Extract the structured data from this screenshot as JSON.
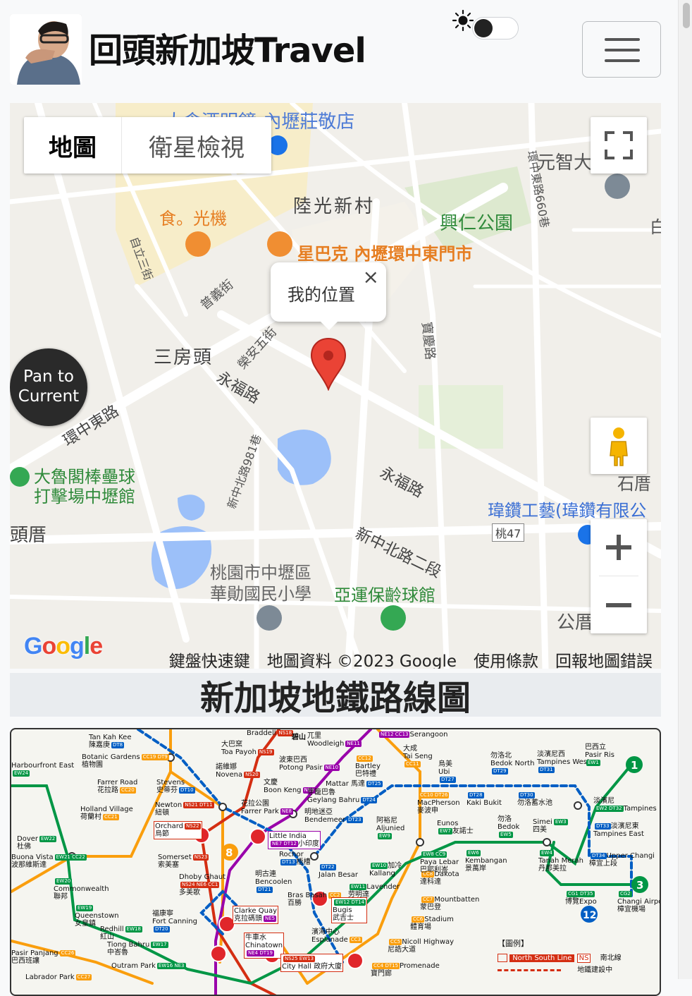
{
  "header": {
    "brand": "回頭新加坡Travel",
    "theme_toggle_state": "off"
  },
  "map": {
    "map_type": {
      "map": "地圖",
      "satellite": "衛星檢視"
    },
    "popup": {
      "text": "我的位置",
      "close": "×"
    },
    "pan_button": {
      "line1": "Pan to",
      "line2": "Current"
    },
    "google_logo": "Google",
    "footer": {
      "shortcuts": "鍵盤快速鍵",
      "data": "地圖資料 ©2023 Google",
      "terms": "使用條款",
      "report": "回報地圖錯誤"
    },
    "labels": {
      "top_partial": "大倉酒明鏡-內壢莊敬店",
      "yuanzhi": "元智大",
      "luguang": "陸光新村",
      "food": "食。光機",
      "xingren": "興仁公園",
      "starbucks": "星巴克 內壢環中東門市",
      "sanfangtou": "三房頭",
      "yongfu_road": "永福路",
      "huanzhongdong": "環中東路",
      "dalu": "大魯閣棒壘球",
      "dalu2": "打擊場中壢館",
      "weizuan": "瑋鑽工藝(瑋鑽有限公",
      "touzuo": "頭厝",
      "xinzhongbei2": "新中北路二段",
      "school1": "桃園市中壢區",
      "school2": "華勛國民小學",
      "bowling": "亞運保齡球館",
      "gongcuo": "公厝",
      "taohe47": "桃47",
      "bai": "白",
      "shicuo": "石厝",
      "xinzhongbei981": "新中北路981巷",
      "yongan5": "榮安五街",
      "lane660": "環中東路660巷",
      "zili3": "自立三街",
      "puyi": "普義街",
      "bao": "寶慶路"
    }
  },
  "section": {
    "title": "新加坡地鐵路線圖"
  },
  "mrt_map": {
    "stations": [
      {
        "name": "Tan Kah Kee",
        "zh": "陳嘉庚",
        "code": "DT8"
      },
      {
        "name": "Botanic Gardens",
        "zh": "植物園",
        "code": "CC19 DT9"
      },
      {
        "name": "Farrer Road",
        "zh": "花拉路",
        "code": "CC20"
      },
      {
        "name": "Holland Village",
        "zh": "荷蘭村",
        "code": "CC21"
      },
      {
        "name": "Stevens",
        "zh": "史蒂芬",
        "code": "DT10"
      },
      {
        "name": "Newton",
        "zh": "紐頓",
        "code": "NS21 DT11"
      },
      {
        "name": "Orchard",
        "zh": "烏節",
        "code": "NS22"
      },
      {
        "name": "Somerset",
        "zh": "索美塞",
        "code": "NS23"
      },
      {
        "name": "Dhoby Ghaut",
        "zh": "多美歌",
        "code": "NS24 NE6 CC1"
      },
      {
        "name": "Commonwealth",
        "zh": "聯邦",
        "code": "EW20"
      },
      {
        "name": "Queenstown",
        "zh": "女皇鎮",
        "code": "EW19"
      },
      {
        "name": "Redhill",
        "zh": "紅山",
        "code": "EW18"
      },
      {
        "name": "Tiong Bahru",
        "zh": "中峇魯",
        "code": "EW17"
      },
      {
        "name": "Outram Park",
        "zh": "歐南園",
        "code": "EW16 NE3"
      },
      {
        "name": "Labrador Park",
        "zh": "",
        "code": "CC27"
      },
      {
        "name": "Pasir Panjang",
        "zh": "巴西班讓",
        "code": "CC26"
      },
      {
        "name": "Novena",
        "zh": "諾維娜",
        "code": "NS20"
      },
      {
        "name": "Toa Payoh",
        "zh": "大巴窯",
        "code": "NS19"
      },
      {
        "name": "Braddell",
        "zh": "",
        "code": "NS18"
      },
      {
        "name": "Bishan",
        "zh": "碧山",
        "code": ""
      },
      {
        "name": "Woodleigh",
        "zh": "兀里",
        "code": "NE11"
      },
      {
        "name": "Potong Pasir",
        "zh": "波東巴西",
        "code": "NE10"
      },
      {
        "name": "Boon Keng",
        "zh": "文慶",
        "code": "NE9"
      },
      {
        "name": "Farrer Park",
        "zh": "花拉公園",
        "code": "NE8"
      },
      {
        "name": "Little India",
        "zh": "小印度",
        "code": "NE7 DT12"
      },
      {
        "name": "Rochor",
        "zh": "梧槽",
        "code": "DT13"
      },
      {
        "name": "Bencoolen",
        "zh": "明古連",
        "code": "DT21"
      },
      {
        "name": "Bras Basah",
        "zh": "百勝",
        "code": "CC2"
      },
      {
        "name": "Bugis",
        "zh": "武吉士",
        "code": "EW12 DT14"
      },
      {
        "name": "Clarke Quay",
        "zh": "克拉碼頭",
        "code": "NE5"
      },
      {
        "name": "Chinatown",
        "zh": "牛車水",
        "code": "NE4 DT19"
      },
      {
        "name": "City Hall",
        "zh": "政府大廈",
        "code": "NS25 EW13"
      },
      {
        "name": "Esplanade",
        "zh": "濱海中心",
        "code": "CC3"
      },
      {
        "name": "Promenade",
        "zh": "寶門廊",
        "code": "CC4 DT15"
      },
      {
        "name": "Nicoll Highway",
        "zh": "尼誥大道",
        "code": "CC5"
      },
      {
        "name": "Stadium",
        "zh": "體育場",
        "code": "CC6"
      },
      {
        "name": "Mountbatten",
        "zh": "蒙巴登",
        "code": "CC7"
      },
      {
        "name": "Dakota",
        "zh": "達科達",
        "code": "CC8"
      },
      {
        "name": "Paya Lebar",
        "zh": "巴耶利峇",
        "code": "EW8 CC9"
      },
      {
        "name": "Aljunied",
        "zh": "阿裕尼",
        "code": "EW9"
      },
      {
        "name": "Kallang",
        "zh": "加冷",
        "code": "EW10"
      },
      {
        "name": "Lavender",
        "zh": "劳明達",
        "code": "EW11"
      },
      {
        "name": "Jalan Besar",
        "zh": "惹蘭勿剎",
        "code": "DT22"
      },
      {
        "name": "Bendemeer",
        "zh": "明地迷亞",
        "code": "DT23"
      },
      {
        "name": "Geylang Bahru",
        "zh": "芽籠巴魯",
        "code": "DT24"
      },
      {
        "name": "Mattar",
        "zh": "馬達",
        "code": "DT25"
      },
      {
        "name": "Bartley",
        "zh": "巴特禮",
        "code": "CC12"
      },
      {
        "name": "Tai Seng",
        "zh": "大成",
        "code": "CC11"
      },
      {
        "name": "Serangoon",
        "zh": "",
        "code": "NE12 CC13"
      },
      {
        "name": "MacPherson",
        "zh": "麥波申",
        "code": "CC10 DT26"
      },
      {
        "name": "Ubi",
        "zh": "烏美",
        "code": "DT27"
      },
      {
        "name": "Kaki Bukit",
        "zh": "加基武吉",
        "code": "DT28"
      },
      {
        "name": "Bedok North",
        "zh": "勿洛北",
        "code": "DT29"
      },
      {
        "name": "Bedok Reservoir",
        "zh": "勿洛蓄水池",
        "code": "DT30"
      },
      {
        "name": "Tampines West",
        "zh": "淡濱尼西",
        "code": "DT31"
      },
      {
        "name": "Eunos",
        "zh": "友諾士",
        "code": "EW7"
      },
      {
        "name": "Kembangan",
        "zh": "景萬岸",
        "code": "EW6"
      },
      {
        "name": "Bedok",
        "zh": "勿洛",
        "code": "EW5"
      },
      {
        "name": "Tanah Merah",
        "zh": "丹那美拉",
        "code": "EW4"
      },
      {
        "name": "Simei",
        "zh": "四美",
        "code": "EW3"
      },
      {
        "name": "Tampines",
        "zh": "淡濱尼",
        "code": "EW2 DT32"
      },
      {
        "name": "Tampines East",
        "zh": "淡濱尼東",
        "code": "DT33"
      },
      {
        "name": "Upper Changi",
        "zh": "樟宜上段",
        "code": "DT34"
      },
      {
        "name": "Expo",
        "zh": "博覽",
        "code": "CG1 DT35"
      },
      {
        "name": "Changi Airport",
        "zh": "樟宜機場",
        "code": "CG2"
      },
      {
        "name": "Pasir Ris",
        "zh": "巴西立",
        "code": "EW1"
      },
      {
        "name": "Fort Canning",
        "zh": "福康寧",
        "code": "DT20"
      },
      {
        "name": "Dover",
        "zh": "杜佛",
        "code": "EW22"
      },
      {
        "name": "Buona Vista",
        "zh": "波那維斯達",
        "code": "EW21 CC22"
      },
      {
        "name": "Harbourfront East",
        "zh": "",
        "code": "EW24"
      }
    ],
    "legend": {
      "title": "【圖例】",
      "ns_line": "North South Line",
      "ns_code": "NS",
      "ns_zh": "南北線",
      "construction": "地鐵建設中"
    }
  },
  "colors": {
    "ns": "#d42e12",
    "ew": "#009645",
    "ne": "#9900aa",
    "cc": "#fa9e0d",
    "dt": "#005ec4",
    "map_road": "#ffffff",
    "map_bg": "#f1efea",
    "map_water": "#9cc0f9",
    "map_park": "#c0ecae"
  }
}
